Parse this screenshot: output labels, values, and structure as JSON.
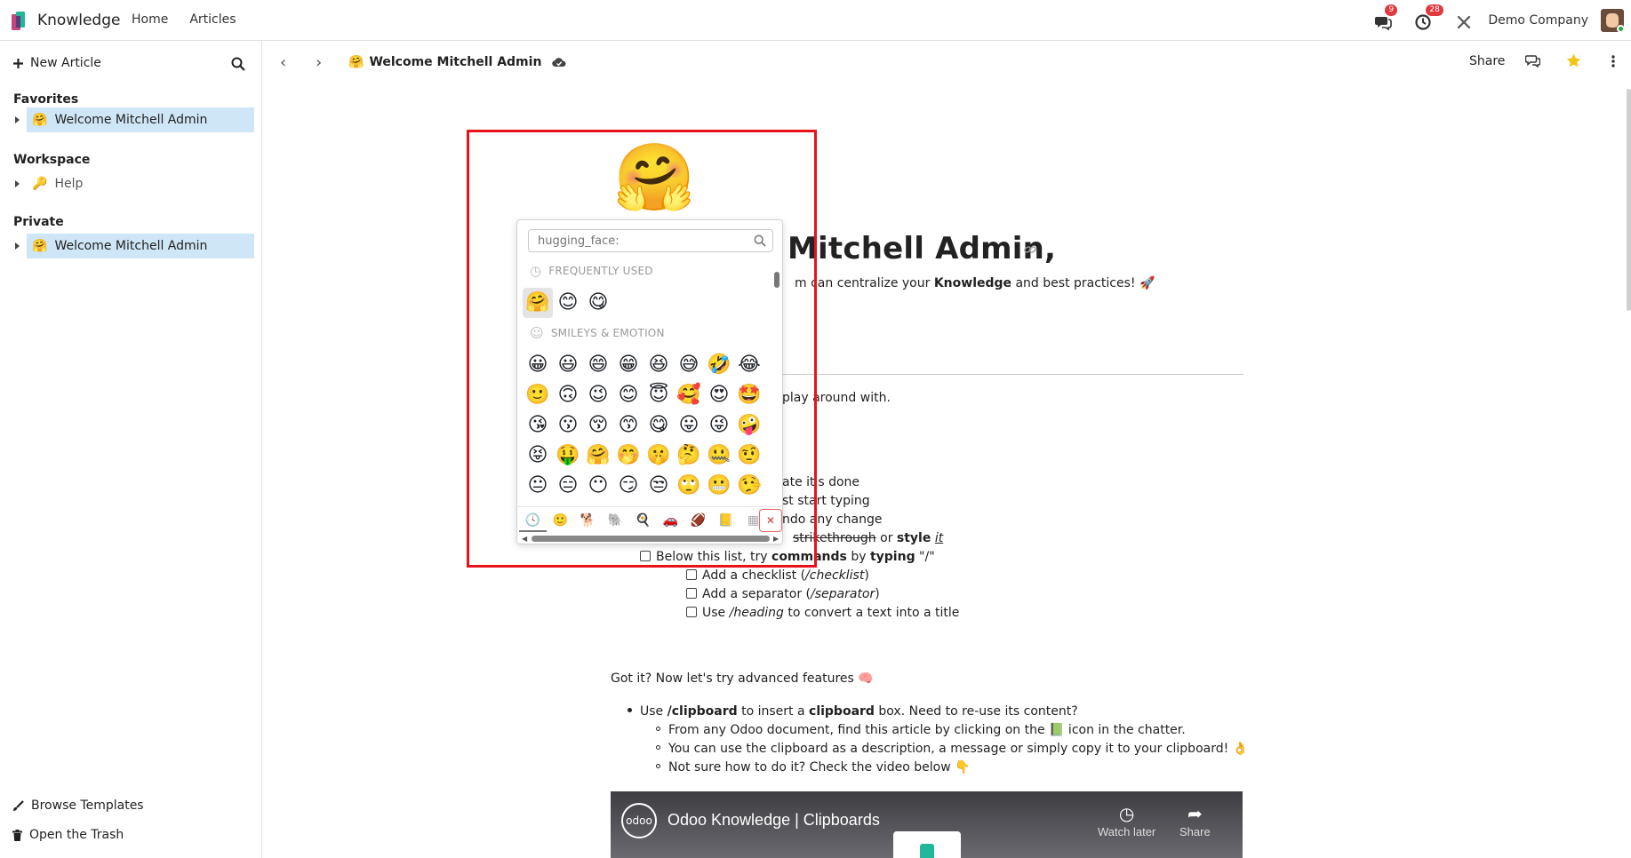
{
  "navbar": {
    "app_name": "Knowledge",
    "menu": [
      "Home",
      "Articles"
    ],
    "messages_count": "9",
    "activities_count": "28",
    "company": "Demo Company"
  },
  "sidebar": {
    "new_article": "New Article",
    "favorites_title": "Favorites",
    "favorites": [
      {
        "emoji": "🤗",
        "label": "Welcome Mitchell Admin"
      }
    ],
    "workspace_title": "Workspace",
    "workspace": [
      {
        "emoji": "🔑",
        "label": "Help"
      }
    ],
    "private_title": "Private",
    "private": [
      {
        "emoji": "🤗",
        "label": "Welcome Mitchell Admin"
      }
    ],
    "browse_templates": "Browse Templates",
    "open_trash": "Open the Trash"
  },
  "article_header": {
    "emoji": "🤗",
    "title": "Welcome Mitchell Admin",
    "share": "Share"
  },
  "article": {
    "icon": "🤗",
    "heading": "Mitchell Admin,",
    "lead_pre": "m can centralize your ",
    "lead_bold": "Knowledge",
    "lead_post": " and best practices! 🚀",
    "play_line": "play around with.",
    "partial_lines": [
      "ate it's done",
      "st start typing",
      "ndo any change"
    ],
    "style_line": {
      "strike": "strikethrough",
      "or": " or ",
      "bold": "style",
      "italic": "it"
    },
    "commands_line": {
      "pre": "Below this list, try ",
      "b1": "commands",
      "mid": " by ",
      "b2": "typing",
      "post": " \"/\""
    },
    "checklist": [
      {
        "pre": "Add a checklist (",
        "em": "/checklist",
        "post": ")"
      },
      {
        "pre": "Add a separator (",
        "em": "/separator",
        "post": ")"
      },
      {
        "pre": "Use ",
        "em": "/heading",
        "post": " to convert a text into a title"
      }
    ],
    "advanced": "Got it? Now let's try advanced features 🧠",
    "clipboard_bullet": {
      "pre": "Use ",
      "b1": "/clipboard",
      "mid": " to insert a ",
      "b2": "clipboard",
      "post": " box. Need to re-use its content?"
    },
    "sub_bullets": [
      "From any Odoo document, find this article by clicking on the 📗 icon in the chatter.",
      "You can use the clipboard as a description, a message or simply copy it to your clipboard! 👌",
      "Not sure how to do it? Check the video below 👇"
    ]
  },
  "video": {
    "logo": "odoo",
    "title": "Odoo Knowledge | Clipboards",
    "watch_later": "Watch later",
    "share": "Share"
  },
  "emoji_picker": {
    "search_placeholder": "hugging_face:",
    "frequently_used_title": "FREQUENTLY USED",
    "frequently_used": [
      "🤗",
      "😊",
      "😋"
    ],
    "smileys_title": "SMILEYS & EMOTION",
    "smileys_rows": [
      [
        "😀",
        "😃",
        "😄",
        "😁",
        "😆",
        "😅",
        "🤣",
        "😂"
      ],
      [
        "🙂",
        "🙃",
        "😉",
        "😊",
        "😇",
        "🥰",
        "😍",
        "🤩"
      ],
      [
        "😘",
        "😗",
        "😚",
        "😙",
        "😋",
        "😛",
        "😜",
        "🤪"
      ],
      [
        "😝",
        "🤑",
        "🤗",
        "🤭",
        "🤫",
        "🤔",
        "🤐",
        "🤨"
      ],
      [
        "😐",
        "😑",
        "😶",
        "😏",
        "😒",
        "🙄",
        "😬",
        "🤥"
      ]
    ],
    "category_tabs": [
      "🕓",
      "🙂",
      "🐕",
      "🐘",
      "🍳",
      "🚗",
      "🏈",
      "📒",
      "▦"
    ],
    "close": "✕"
  }
}
